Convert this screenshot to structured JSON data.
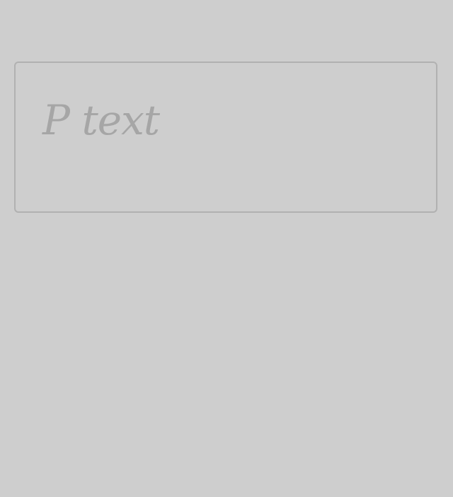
{
  "content_box": {
    "text": "P text"
  }
}
